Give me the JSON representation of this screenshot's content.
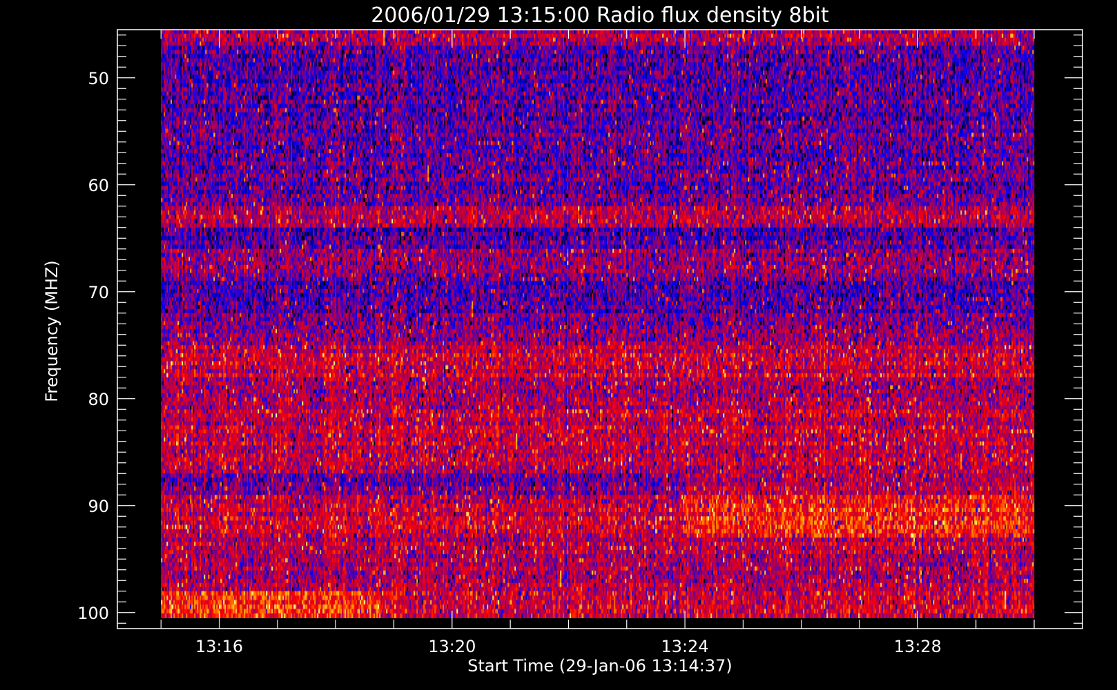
{
  "chart_data": {
    "type": "heatmap",
    "title": "2006/01/29 13:15:00 Radio flux density 8bit",
    "xlabel": "Start Time (29-Jan-06 13:14:37)",
    "ylabel": "Frequency (MHZ)",
    "x_ticks": [
      "13:16",
      "13:20",
      "13:24",
      "13:28"
    ],
    "x_tick_values_min": [
      16,
      20,
      24,
      28
    ],
    "xlim_min": [
      14.25,
      30.83
    ],
    "data_x_range_min": [
      15.0,
      30.0
    ],
    "y_ticks": [
      50,
      60,
      70,
      80,
      90,
      100
    ],
    "ylim": [
      45.5,
      101.5
    ],
    "y_inverted": true,
    "data_y_range": [
      45.5,
      100.5
    ],
    "grid": false,
    "colormap": [
      "#000000",
      "#0000ff",
      "#a00060",
      "#ff0000",
      "#ffa000",
      "#ffff80"
    ],
    "frequency_bands": [
      {
        "f0": 45.5,
        "f1": 47.0,
        "mean": 0.45
      },
      {
        "f0": 47.0,
        "f1": 54.0,
        "mean": 0.3
      },
      {
        "f0": 54.0,
        "f1": 62.0,
        "mean": 0.32
      },
      {
        "f0": 62.0,
        "f1": 64.0,
        "mean": 0.45
      },
      {
        "f0": 64.0,
        "f1": 66.0,
        "mean": 0.28
      },
      {
        "f0": 66.0,
        "f1": 69.0,
        "mean": 0.38
      },
      {
        "f0": 69.0,
        "f1": 72.0,
        "mean": 0.28
      },
      {
        "f0": 72.0,
        "f1": 75.0,
        "mean": 0.38
      },
      {
        "f0": 75.0,
        "f1": 78.0,
        "mean": 0.5
      },
      {
        "f0": 78.0,
        "f1": 81.0,
        "mean": 0.42
      },
      {
        "f0": 81.0,
        "f1": 87.0,
        "mean": 0.48
      },
      {
        "f0": 87.0,
        "f1": 89.0,
        "mean": 0.35
      },
      {
        "f0": 89.0,
        "f1": 93.0,
        "mean": 0.5
      },
      {
        "f0": 93.0,
        "f1": 98.0,
        "mean": 0.45
      },
      {
        "f0": 98.0,
        "f1": 100.5,
        "mean": 0.5
      }
    ]
  }
}
